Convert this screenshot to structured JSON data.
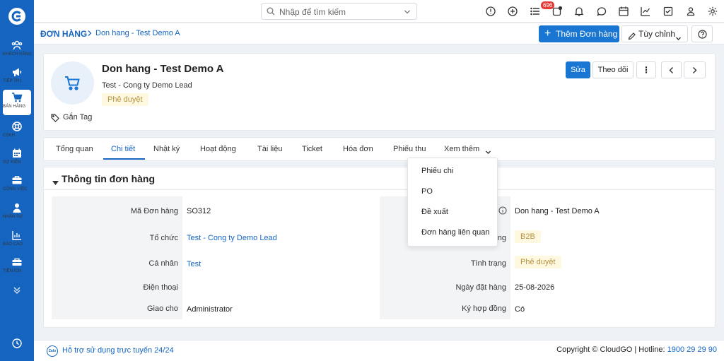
{
  "colors": {
    "primary": "#1565c0",
    "sidebar": "#1565c0",
    "status_bg": "#fff8e1",
    "status_text": "#b39242",
    "badge": "#e53935"
  },
  "sidebar": {
    "items": [
      {
        "label": "KHÁCH HÀNG",
        "icon": "users-icon"
      },
      {
        "label": "TIẾP THỊ",
        "icon": "megaphone-icon"
      },
      {
        "label": "BÁN HÀNG",
        "icon": "cart-icon",
        "active": true
      },
      {
        "label": "CSKH",
        "icon": "lifebuoy-icon"
      },
      {
        "label": "SỰ KIỆN",
        "icon": "calendar-icon"
      },
      {
        "label": "CÔNG VIỆC",
        "icon": "briefcase-icon"
      },
      {
        "label": "NHÂN SỰ",
        "icon": "person-icon"
      },
      {
        "label": "BÁO CÁO",
        "icon": "report-icon"
      },
      {
        "label": "TIỆN ÍCH",
        "icon": "toolbox-icon"
      }
    ]
  },
  "topbar": {
    "search_placeholder": "Nhập để tìm kiếm",
    "notification_count": "696"
  },
  "breadcrumb": {
    "root": "ĐƠN HÀNG",
    "current": "Don hang - Test Demo A"
  },
  "actions": {
    "add_label": "Thêm Đơn hàng",
    "customize_label": "Tùy chỉnh"
  },
  "record": {
    "title": "Don hang - Test Demo A",
    "subtitle": "Test - Cong ty Demo Lead",
    "status": "Phê duyệt",
    "tag_label": "Gắn Tag",
    "edit_label": "Sửa",
    "follow_label": "Theo dõi"
  },
  "tabs": [
    {
      "label": "Tổng quan"
    },
    {
      "label": "Chi tiết",
      "active": true
    },
    {
      "label": "Nhật ký"
    },
    {
      "label": "Hoạt động"
    },
    {
      "label": "Tài liệu"
    },
    {
      "label": "Ticket"
    },
    {
      "label": "Hóa đơn"
    },
    {
      "label": "Phiếu thu"
    },
    {
      "label": "Xem thêm"
    }
  ],
  "dropdown": {
    "items": [
      "Phiếu chi",
      "PO",
      "Đề xuất",
      "Đơn hàng liên quan"
    ]
  },
  "details": {
    "section_title": "Thông tin đơn hàng",
    "left": [
      {
        "label": "Mã Đơn hàng",
        "value": "SO312"
      },
      {
        "label": "Tổ chức",
        "value": "Test - Cong ty Demo Lead"
      },
      {
        "label": "Cá nhân",
        "value": "Test"
      },
      {
        "label": "Điện thoại",
        "value": ""
      },
      {
        "label": "Giao cho",
        "value": "Administrator"
      }
    ],
    "right": [
      {
        "label": "",
        "value": "Don hang - Test Demo A"
      },
      {
        "label": "ng",
        "value": "B2B"
      },
      {
        "label": "Tình trạng",
        "value": "Phê duyệt"
      },
      {
        "label": "Ngày đặt hàng",
        "value": "25-08-2026"
      },
      {
        "label": "Ký hợp đồng",
        "value": "Có"
      }
    ]
  },
  "footer": {
    "zalo_label": "Zalo",
    "support": "Hỗ trợ sử dụng trực tuyến 24/24",
    "copyright_prefix": "Copyright © CloudGO | Hotline: ",
    "hotline": "1900 29 29 90"
  }
}
